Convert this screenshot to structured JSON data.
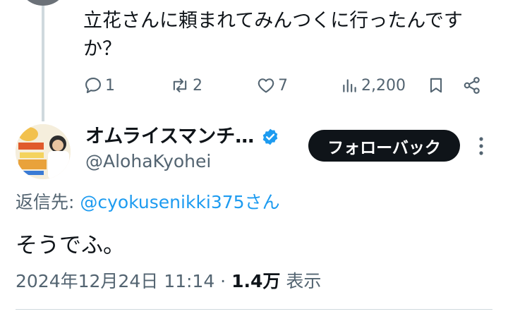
{
  "previous_tweet": {
    "text": "立花さんに頼まれてみんつくに行ったんですか？",
    "actions": {
      "reply_count": "1",
      "retweet_count": "2",
      "like_count": "7",
      "view_count": "2,200"
    }
  },
  "reply_tweet": {
    "display_name": "オムライスマンチ…",
    "handle": "@AlohaKyohei",
    "follow_button_label": "フォローバック",
    "reply_to_prefix": "返信先: ",
    "reply_to_mention": "@cyokusenikki375",
    "reply_to_suffix": "さん",
    "text": "そうでふ。",
    "timestamp": "2024年12月24日 11:14 · ",
    "views_count": "1.4万",
    "views_label": " 表示"
  },
  "colors": {
    "text": "#0f1419",
    "secondary": "#536471",
    "accent": "#1d9bf0",
    "divider": "#cfd9de"
  },
  "icons": [
    "reply-icon",
    "retweet-icon",
    "like-icon",
    "views-icon",
    "bookmark-icon",
    "share-icon",
    "verified-icon",
    "more-icon"
  ]
}
